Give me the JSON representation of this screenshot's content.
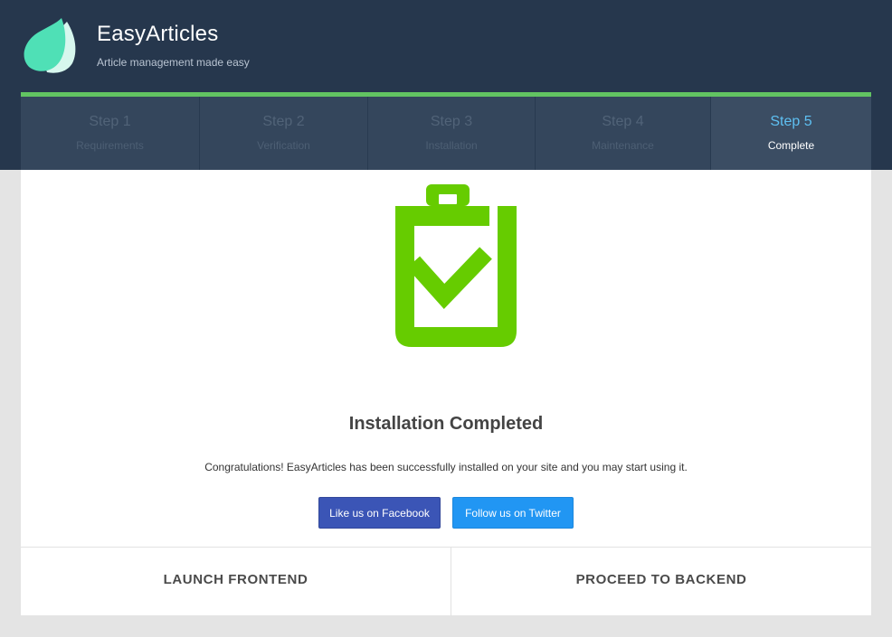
{
  "header": {
    "title": "EasyArticles",
    "tagline": "Article management made easy",
    "logo_icon": "leaf-drop-icon"
  },
  "steps": [
    {
      "title": "Step 1",
      "subtitle": "Requirements"
    },
    {
      "title": "Step 2",
      "subtitle": "Verification"
    },
    {
      "title": "Step 3",
      "subtitle": "Installation"
    },
    {
      "title": "Step 4",
      "subtitle": "Maintenance"
    },
    {
      "title": "Step 5",
      "subtitle": "Complete"
    }
  ],
  "active_step": "Step 5",
  "main": {
    "icon": "clipboard-check-icon",
    "title": "Installation Completed",
    "message": "Congratulations! EasyArticles has been successfully installed on your site and you may start using it.",
    "facebook_label": "Like us on Facebook",
    "twitter_label": "Follow us on Twitter"
  },
  "footer": {
    "frontend_label": "LAUNCH FRONTEND",
    "backend_label": "PROCEED TO BACKEND"
  },
  "colors": {
    "header_bg": "#26374d",
    "progress_accent": "#62c462",
    "active_step": "#5ec0f2",
    "success_green": "#66cc00",
    "facebook": "#3b55b6",
    "twitter": "#2196f3"
  }
}
